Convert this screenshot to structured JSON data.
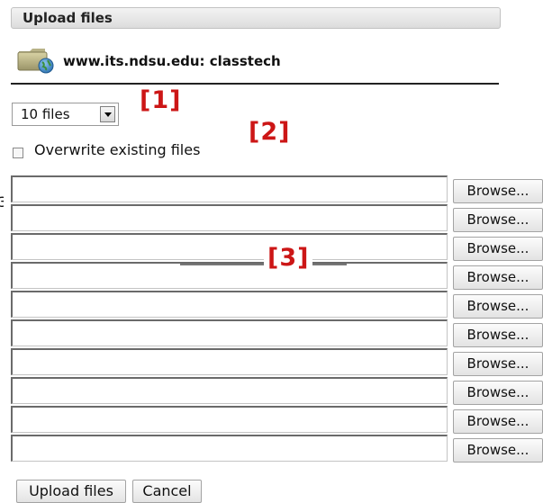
{
  "header": {
    "title": "Upload files"
  },
  "site": {
    "name": "www.its.ndsu.edu: classtech",
    "icon": "folder-globe-icon"
  },
  "file_count_select": {
    "selected": "10 files"
  },
  "overwrite": {
    "label": "Overwrite existing files",
    "checked": false
  },
  "annotations": {
    "a1": "[1]",
    "a2": "[2]",
    "a3": "[3]",
    "color": "#cc1616"
  },
  "file_rows": [
    {
      "value": "",
      "browse_label": "Browse..."
    },
    {
      "value": "",
      "browse_label": "Browse..."
    },
    {
      "value": "",
      "browse_label": "Browse..."
    },
    {
      "value": "",
      "browse_label": "Browse..."
    },
    {
      "value": "",
      "browse_label": "Browse..."
    },
    {
      "value": "",
      "browse_label": "Browse..."
    },
    {
      "value": "",
      "browse_label": "Browse..."
    },
    {
      "value": "",
      "browse_label": "Browse..."
    },
    {
      "value": "",
      "browse_label": "Browse..."
    },
    {
      "value": "",
      "browse_label": "Browse..."
    }
  ],
  "footer": {
    "upload_label": "Upload files",
    "cancel_label": "Cancel"
  }
}
